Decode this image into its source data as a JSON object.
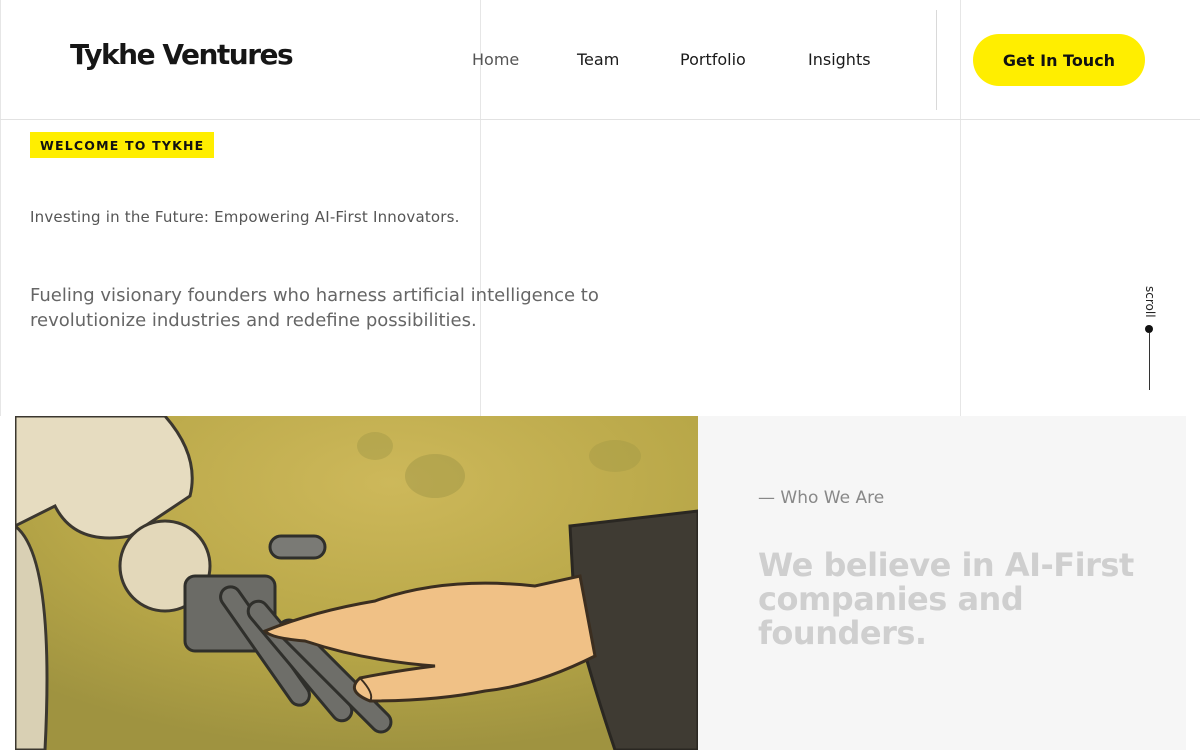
{
  "header": {
    "logo": "Tykhe Ventures",
    "nav": [
      {
        "label": "Home",
        "active": true
      },
      {
        "label": "Team",
        "active": false
      },
      {
        "label": "Portfolio",
        "active": false
      },
      {
        "label": "Insights",
        "active": false
      }
    ],
    "cta_label": "Get In Touch"
  },
  "hero": {
    "badge": "WELCOME TO TYKHE",
    "tagline": "Investing in the Future: Empowering AI-First Innovators.",
    "lead": "Fueling visionary founders who harness artificial intelligence to revolutionize industries and redefine possibilities.",
    "scroll_label": "scroll",
    "image_icon": "robot-human-handshake-illustration"
  },
  "about": {
    "kicker": "— Who We Are",
    "heading": "We believe in AI-First companies and founders."
  },
  "colors": {
    "accent": "#ffee00",
    "text_dark": "#111111",
    "muted_heading": "#cfcfcf",
    "panel_bg": "#f6f6f6"
  }
}
